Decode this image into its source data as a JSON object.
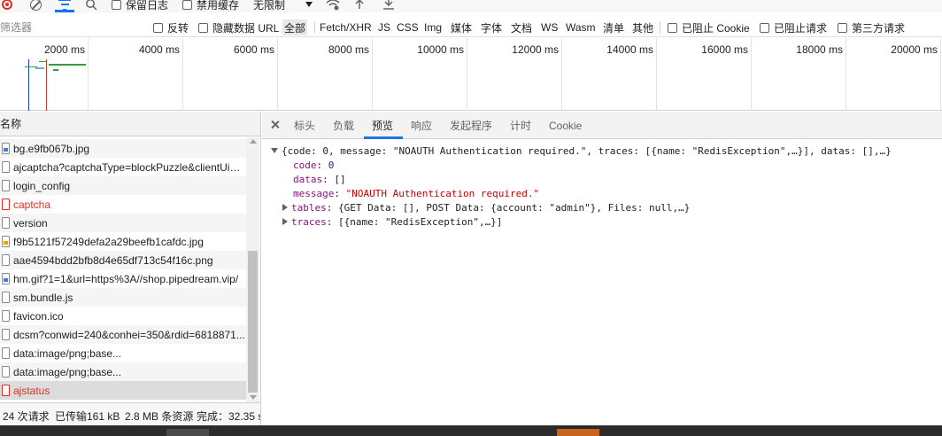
{
  "toolbar": {
    "preserve_log_label": "保留日志",
    "disable_cache_label": "禁用缓存",
    "throttle_label": "无限制"
  },
  "filter": {
    "placeholder": "筛选器",
    "invert_label": "反转",
    "hide_data_urls_label": "隐藏数据 URL",
    "types": [
      "全部",
      "Fetch/XHR",
      "JS",
      "CSS",
      "Img",
      "媒体",
      "字体",
      "文档",
      "WS",
      "Wasm",
      "清单",
      "其他"
    ],
    "active_type": "全部",
    "blocked_cookies_label": "已阻止 Cookie",
    "blocked_requests_label": "已阻止请求",
    "third_party_label": "第三方请求"
  },
  "timeline": {
    "ticks": [
      "2000 ms",
      "4000 ms",
      "6000 ms",
      "8000 ms",
      "10000 ms",
      "12000 ms",
      "14000 ms",
      "16000 ms",
      "18000 ms",
      "20000 ms"
    ],
    "colors": {
      "dom_line": "#1a3fbf",
      "load_line": "#c0392b",
      "bar": "#2ea043"
    }
  },
  "request_list": {
    "header": "名称",
    "rows": [
      {
        "name": "bg.e9fb067b.jpg",
        "type": "img",
        "error": false
      },
      {
        "name": "ajcaptcha?captchaType=blockPuzzle&clientUid=s",
        "type": "doc",
        "error": false
      },
      {
        "name": "login_config",
        "type": "doc",
        "error": false
      },
      {
        "name": "captcha",
        "type": "doc",
        "error": true
      },
      {
        "name": "version",
        "type": "doc",
        "error": false
      },
      {
        "name": "f9b5121f57249defa2a29beefb1cafdc.jpg",
        "type": "img-y",
        "error": false
      },
      {
        "name": "aae4594bdd2bfb8d4e65df713c54f16c.png",
        "type": "doc",
        "error": false
      },
      {
        "name": "hm.gif?1=1&url=https%3A//shop.pipedream.vip/",
        "type": "img",
        "error": false
      },
      {
        "name": "sm.bundle.js",
        "type": "doc",
        "error": false
      },
      {
        "name": "favicon.ico",
        "type": "doc",
        "error": false
      },
      {
        "name": "dcsm?conwid=240&conhei=350&rdid=6818871...",
        "type": "doc",
        "error": false
      },
      {
        "name": "data:image/png;base...",
        "type": "doc",
        "error": false
      },
      {
        "name": "data:image/png;base...",
        "type": "doc",
        "error": false
      },
      {
        "name": "ajstatus",
        "type": "doc",
        "error": true,
        "selected": true
      }
    ]
  },
  "status": {
    "requests": "24 次请求",
    "transferred": "已传输161 kB",
    "resources": "2.8 MB 条资源",
    "finish": "完成：32.35 s"
  },
  "detail": {
    "tabs": [
      "标头",
      "负载",
      "预览",
      "响应",
      "发起程序",
      "计时",
      "Cookie"
    ],
    "active_tab": "预览",
    "preview": {
      "root_summary": "{code: 0, message: \"NOAUTH Authentication required.\", traces: [{name: \"RedisException\",…}], datas: [],…}",
      "code_key": "code",
      "code_value": "0",
      "datas_key": "datas",
      "datas_value": "[]",
      "message_key": "message",
      "message_value": "\"NOAUTH Authentication required.\"",
      "tables_key": "tables",
      "tables_value": "{GET Data: [], POST Data: {account: \"admin\"}, Files: null,…}",
      "traces_key": "traces",
      "traces_value": "[{name: \"RedisException\",…}]"
    }
  }
}
